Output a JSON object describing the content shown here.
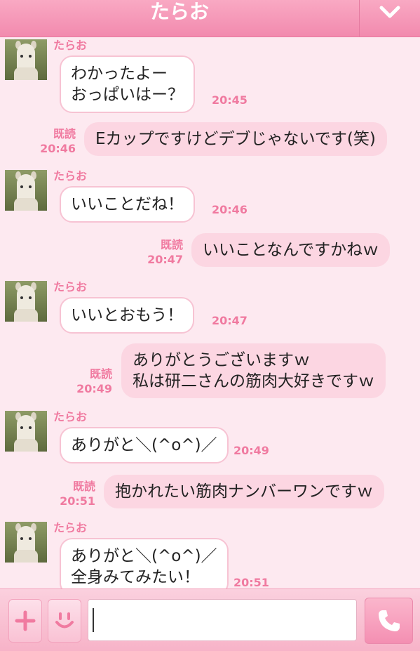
{
  "header": {
    "title": "たらお"
  },
  "messages": [
    {
      "direction": "in",
      "sender": "たらお",
      "lines": [
        "わかったよー",
        "おっぱいはー？"
      ],
      "time": "20:45"
    },
    {
      "direction": "out",
      "read": "既読",
      "lines": [
        "Eカップですけどデブじゃないです(笑)"
      ],
      "time": "20:46"
    },
    {
      "direction": "in",
      "sender": "たらお",
      "lines": [
        "いいことだね！"
      ],
      "time": "20:46"
    },
    {
      "direction": "out",
      "read": "既読",
      "lines": [
        "いいことなんですかねｗ"
      ],
      "time": "20:47"
    },
    {
      "direction": "in",
      "sender": "たらお",
      "lines": [
        "いいとおもう！"
      ],
      "time": "20:47"
    },
    {
      "direction": "out",
      "read": "既読",
      "lines": [
        "ありがとうございますｗ",
        "私は研二さんの筋肉大好きですｗ"
      ],
      "time": "20:49"
    },
    {
      "direction": "in",
      "sender": "たらお",
      "lines": [
        "ありがと＼(^o^)／"
      ],
      "time": "20:49"
    },
    {
      "direction": "out",
      "read": "既読",
      "lines": [
        "抱かれたい筋肉ナンバーワンですｗ"
      ],
      "time": "20:51"
    },
    {
      "direction": "in",
      "sender": "たらお",
      "lines": [
        "ありがと＼(^o^)／",
        "全身みてみたい！"
      ],
      "time": "20:51"
    }
  ],
  "footer": {
    "input_value": ""
  },
  "icons": {
    "menu": "chevron-down-icon",
    "add": "plus-icon",
    "emoji": "smiley-icon",
    "call": "phone-icon"
  },
  "colors": {
    "accent": "#f28aae",
    "background": "#fde9f0",
    "outgoing_bubble": "#fcd6e2",
    "label": "#f07aa0"
  }
}
